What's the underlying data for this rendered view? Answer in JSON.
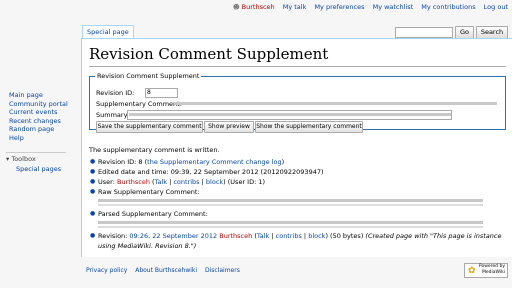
{
  "personal": {
    "username": "Burthsceh",
    "links": [
      "My talk",
      "My preferences",
      "My watchlist",
      "My contributions",
      "Log out"
    ]
  },
  "tabs": {
    "special": "Special page"
  },
  "search": {
    "go": "Go",
    "search": "Search",
    "value": ""
  },
  "title": "Revision Comment Supplement",
  "form": {
    "legend": "Revision Comment Supplement",
    "revision_label": "Revision ID:",
    "revision_value": "8",
    "supplementary_label": "Supplementary Comment:",
    "summary_label": "Summary:",
    "buttons": [
      "Save the supplementary comment",
      "Show preview",
      "Show the supplementary comment"
    ]
  },
  "result": {
    "written": "The supplementary comment is written.",
    "revision_prefix": "Revision ID: 8 (",
    "revision_link": "the Supplementary Comment change log",
    "revision_suffix": ")",
    "edited": "Edited date and time: 09:39, 22 September 2012 (20120922093947)",
    "user_prefix": "User: ",
    "user_name": "Burthsceh",
    "user_open": " (",
    "user_talk": "Talk",
    "sep": " | ",
    "user_contribs": "contribs",
    "user_block": "block",
    "user_suffix": ") (User ID: 1)",
    "raw_label": "Raw Supplementary Comment:",
    "parsed_label": "Parsed Supplementary Comment:",
    "rev_prefix": "Revision: ",
    "rev_time": "09:26, 22 September 2012",
    "rev_user": "Burthsceh",
    "rev_talk": "Talk",
    "rev_contribs": "contribs",
    "rev_block": "block",
    "rev_bytes": ") (50 bytes) ",
    "rev_comment": "(Created page with \"This page is instance using MediaWiki. Revision 8.\")"
  },
  "sidebar": {
    "items": [
      "Main page",
      "Community portal",
      "Current events",
      "Recent changes",
      "Random page",
      "Help"
    ],
    "toolbox_heading": "Toolbox",
    "toolbox_items": [
      "Special pages"
    ]
  },
  "footer": {
    "links": [
      "Privacy policy",
      "About Burthscehwiki",
      "Disclaimers"
    ],
    "badge_line1": "Powered by",
    "badge_line2": "MediaWiki"
  }
}
